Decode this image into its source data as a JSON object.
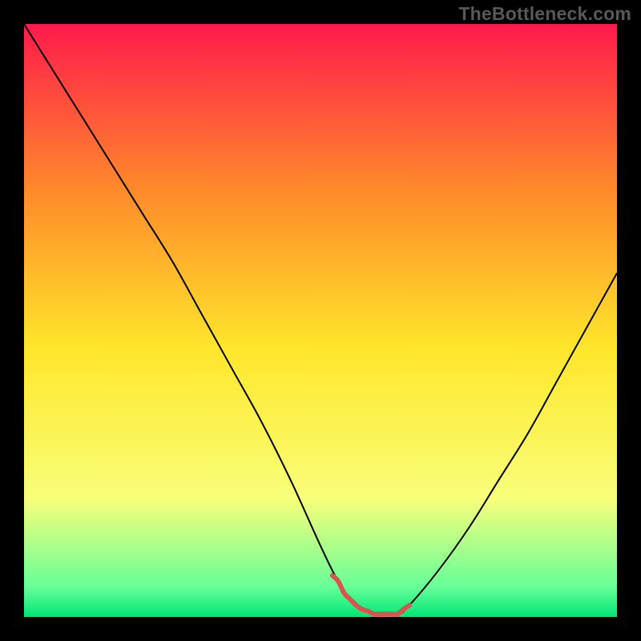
{
  "watermark": "TheBottleneck.com",
  "chart_data": {
    "type": "line",
    "title": "",
    "xlabel": "",
    "ylabel": "",
    "xlim": [
      0,
      100
    ],
    "ylim": [
      0,
      100
    ],
    "grid": false,
    "legend": false,
    "background_gradient": {
      "top": "#ff1a4b",
      "upper_mid": "#ff8a2b",
      "mid": "#ffe72b",
      "lower_mid": "#f8ff7a",
      "near_bottom": "#66ff99",
      "bottom": "#00e676"
    },
    "series": [
      {
        "name": "curve",
        "color": "#000000",
        "stroke_width": 2,
        "x": [
          0,
          5,
          10,
          15,
          20,
          25,
          30,
          35,
          40,
          45,
          50,
          53,
          56,
          59,
          63,
          65,
          70,
          75,
          80,
          85,
          90,
          95,
          100
        ],
        "values": [
          100,
          92,
          84,
          76,
          68,
          60,
          51,
          42,
          33,
          23,
          12,
          6,
          2,
          0.5,
          0.5,
          2,
          8,
          15,
          23,
          31,
          40,
          49,
          58
        ]
      },
      {
        "name": "minimum-marker",
        "color": "#d9544f",
        "stroke_width": 6,
        "x": [
          52,
          53,
          54,
          55,
          56,
          57,
          58,
          59,
          60,
          61,
          62,
          63,
          64,
          65
        ],
        "values": [
          7,
          6,
          4,
          3,
          2,
          1.3,
          1,
          0.5,
          0.5,
          0.5,
          0.5,
          0.5,
          1.3,
          2
        ]
      }
    ]
  }
}
